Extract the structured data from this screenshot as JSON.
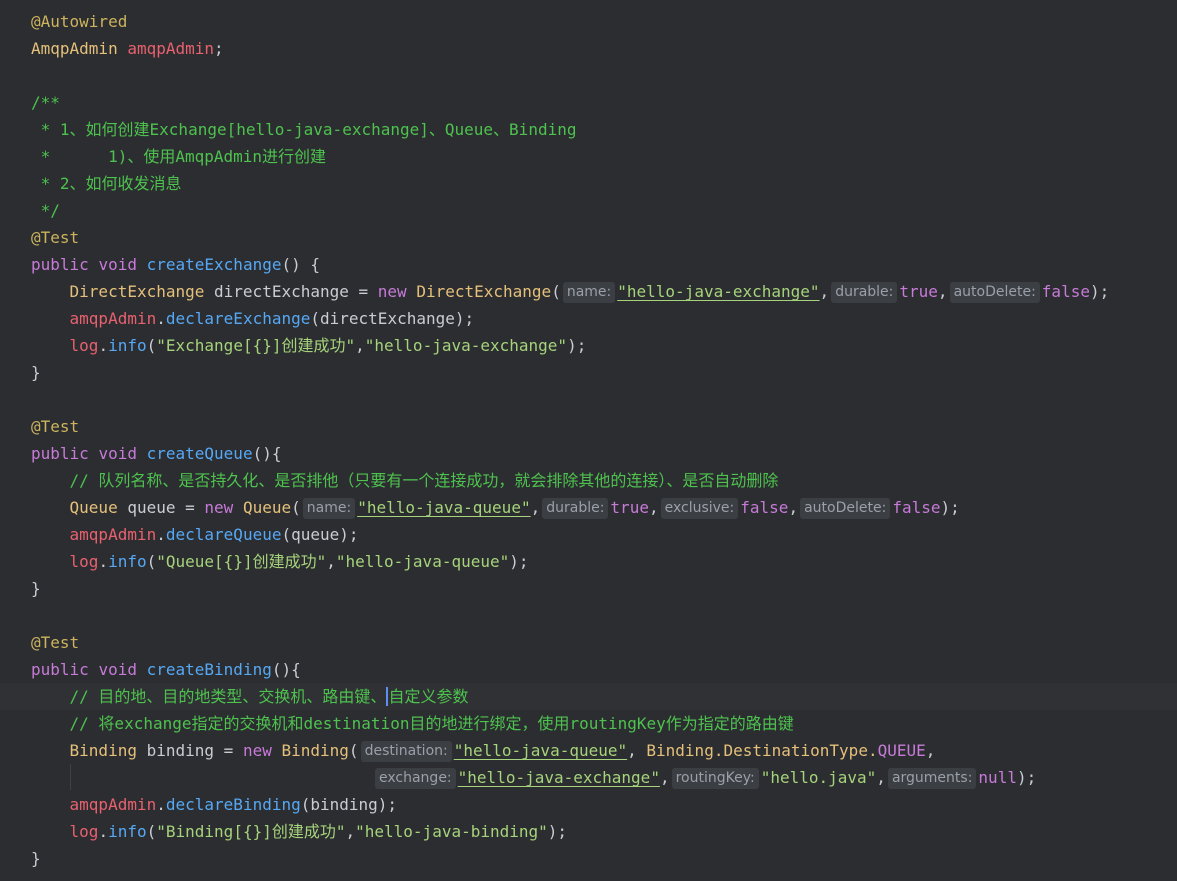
{
  "editor": {
    "lines": {
      "l01": {
        "annotation": "@Autowired"
      },
      "l02": {
        "type": "AmqpAdmin",
        "field": "amqpAdmin",
        "end": ";"
      },
      "l04": {
        "text": "/**"
      },
      "l05": {
        "text": " * 1、如何创建Exchange[hello-java-exchange]、Queue、Binding"
      },
      "l06": {
        "text": " *      1)、使用AmqpAdmin进行创建"
      },
      "l07": {
        "text": " * 2、如何收发消息"
      },
      "l08": {
        "text": " */"
      },
      "l09": {
        "annotation": "@Test"
      },
      "l10": {
        "kw1": "public",
        "kw2": "void",
        "method": "createExchange",
        "rest": "() {"
      },
      "l11": {
        "type": "DirectExchange",
        "var": " directExchange = ",
        "kw": "new",
        "ctor": "DirectExchange",
        "open": "(",
        "hint1": "name:",
        "str1": "\"hello-java-exchange\"",
        "comma1": ",",
        "hint2": "durable:",
        "val2": "true",
        "comma2": ",",
        "hint3": "autoDelete:",
        "val3": "false",
        "end": ");"
      },
      "l12": {
        "field": "amqpAdmin",
        "dot": ".",
        "method": "declareExchange",
        "rest": "(directExchange);"
      },
      "l13": {
        "field": "log",
        "dot": ".",
        "method": "info",
        "open": "(",
        "str1": "\"Exchange[{}]创建成功\"",
        "comma": ",",
        "str2": "\"hello-java-exchange\"",
        "end": ");"
      },
      "l14": {
        "text": "}"
      },
      "l16": {
        "annotation": "@Test"
      },
      "l17": {
        "kw1": "public",
        "kw2": "void",
        "method": "createQueue",
        "rest": "(){"
      },
      "l18": {
        "text": "// 队列名称、是否持久化、是否排他（只要有一个连接成功，就会排除其他的连接）、是否自动删除"
      },
      "l19": {
        "type": "Queue",
        "var": " queue = ",
        "kw": "new",
        "ctor": "Queue",
        "open": "(",
        "hint1": "name:",
        "str1": "\"hello-java-queue\"",
        "comma1": ",",
        "hint2": "durable:",
        "val2": "true",
        "comma2": ",",
        "hint3": "exclusive:",
        "val3": "false",
        "comma3": ",",
        "hint4": "autoDelete:",
        "val4": "false",
        "end": ");"
      },
      "l20": {
        "field": "amqpAdmin",
        "dot": ".",
        "method": "declareQueue",
        "rest": "(queue);"
      },
      "l21": {
        "field": "log",
        "dot": ".",
        "method": "info",
        "open": "(",
        "str1": "\"Queue[{}]创建成功\"",
        "comma": ",",
        "str2": "\"hello-java-queue\"",
        "end": ");"
      },
      "l22": {
        "text": "}"
      },
      "l24": {
        "annotation": "@Test"
      },
      "l25": {
        "kw1": "public",
        "kw2": "void",
        "method": "createBinding",
        "rest": "(){"
      },
      "l26": {
        "before": "// 目的地、目的地类型、交换机、路由键、",
        "after": "自定义参数"
      },
      "l27": {
        "text": "// 将exchange指定的交换机和destination目的地进行绑定，使用routingKey作为指定的路由键"
      },
      "l28": {
        "type": "Binding",
        "var": " binding = ",
        "kw": "new",
        "ctor": "Binding",
        "open": "(",
        "hint1": "destination:",
        "str1": "\"hello-java-queue\"",
        "comma1": ", ",
        "type2": "Binding.DestinationType.",
        "const": "QUEUE",
        "comma2": ","
      },
      "l29": {
        "hint1": "exchange:",
        "str1": "\"hello-java-exchange\"",
        "comma1": ",",
        "hint2": "routingKey:",
        "str2": "\"hello.java\"",
        "comma2": ",",
        "hint3": "arguments:",
        "val3": "null",
        "end": ");"
      },
      "l30": {
        "field": "amqpAdmin",
        "dot": ".",
        "method": "declareBinding",
        "rest": "(binding);"
      },
      "l31": {
        "field": "log",
        "dot": ".",
        "method": "info",
        "open": "(",
        "str1": "\"Binding[{}]创建成功\"",
        "comma": ",",
        "str2": "\"hello-java-binding\"",
        "end": ");"
      },
      "l32": {
        "text": "}"
      }
    },
    "colors": {
      "background": "#2b2d30",
      "keyword": "#c77ad8",
      "method": "#56a8f5",
      "field": "#e8616f",
      "string": "#a6d37b",
      "comment": "#4ec24e",
      "annotation": "#cdb35e"
    },
    "gutter_icon": "lightbulb-icon"
  }
}
